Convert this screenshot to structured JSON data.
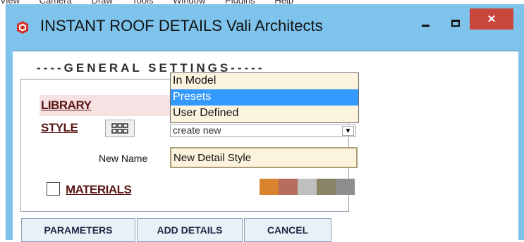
{
  "host_menu": [
    "View",
    "Camera",
    "Draw",
    "Tools",
    "Window",
    "Plugins",
    "Help"
  ],
  "window": {
    "title": "INSTANT ROOF DETAILS  Vali Architects",
    "close_glyph": "✕",
    "titlebar_color": "#7dc3ec",
    "close_color": "#c9463d"
  },
  "panel": {
    "legend": "----GENERAL SETTINGS-----",
    "library_label": "LIBRARY",
    "style_label": "STYLE",
    "style_select_value": "create new",
    "new_name_label": "New Name",
    "new_name_value": "New Detail Style",
    "materials_label": "MATERIALS",
    "materials_checked": false,
    "swatch_colors": [
      "#d9832e",
      "#b66c5e",
      "#bfbfbf",
      "#8a8467",
      "#8e8e8e"
    ]
  },
  "library_dropdown": {
    "options": [
      "In Model",
      "Presets",
      "User Defined"
    ],
    "selected": "Presets",
    "highlight_color": "#3399ff"
  },
  "buttons": {
    "parameters": "PARAMETERS",
    "add_details": "ADD DETAILS",
    "cancel": "CANCEL"
  }
}
